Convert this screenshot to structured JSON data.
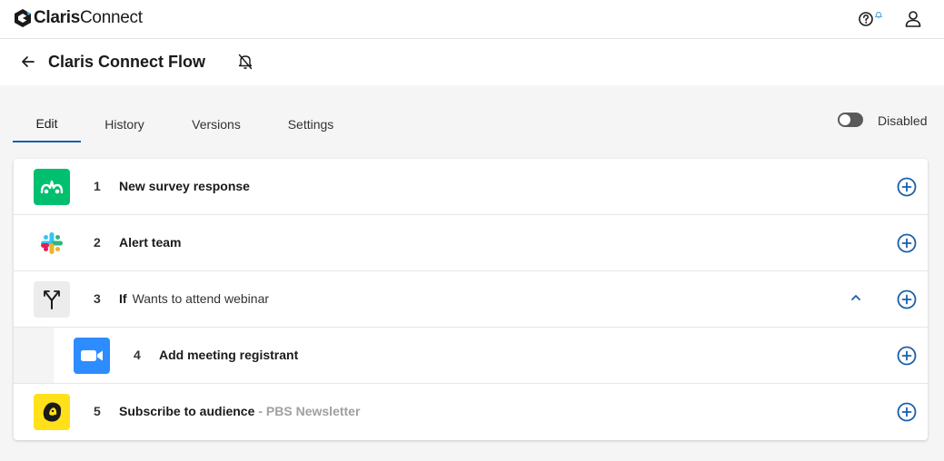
{
  "brand": {
    "name_bold": "Claris",
    "name_light": "Connect"
  },
  "header": {
    "help_icon": "help-circle-icon",
    "user_icon": "user-icon"
  },
  "flow": {
    "title": "Claris Connect Flow",
    "back_icon": "arrow-left-icon",
    "bell_icon": "bell-off-icon"
  },
  "tabs": [
    {
      "label": "Edit",
      "active": true
    },
    {
      "label": "History",
      "active": false
    },
    {
      "label": "Versions",
      "active": false
    },
    {
      "label": "Settings",
      "active": false
    }
  ],
  "status": {
    "enabled": false,
    "label": "Disabled"
  },
  "steps": [
    {
      "num": "1",
      "title": "New survey response",
      "icon": "surveymonkey-icon",
      "color": "#00bf6f"
    },
    {
      "num": "2",
      "title": "Alert team",
      "icon": "slack-icon",
      "color": "#ffffff"
    },
    {
      "num": "3",
      "title": "If",
      "condition": "Wants to attend webinar",
      "icon": "branch-icon",
      "color": "#eeeeee",
      "expanded": true
    },
    {
      "num": "4",
      "title": "Add meeting registrant",
      "icon": "zoom-icon",
      "color": "#2d8cff",
      "nested": true
    },
    {
      "num": "5",
      "title": "Subscribe to audience",
      "subtitle": "- PBS Newsletter",
      "icon": "mailchimp-icon",
      "color": "#ffe01b"
    }
  ],
  "colors": {
    "accent": "#1a5fa8",
    "active_tab": "#1a5fa8"
  }
}
